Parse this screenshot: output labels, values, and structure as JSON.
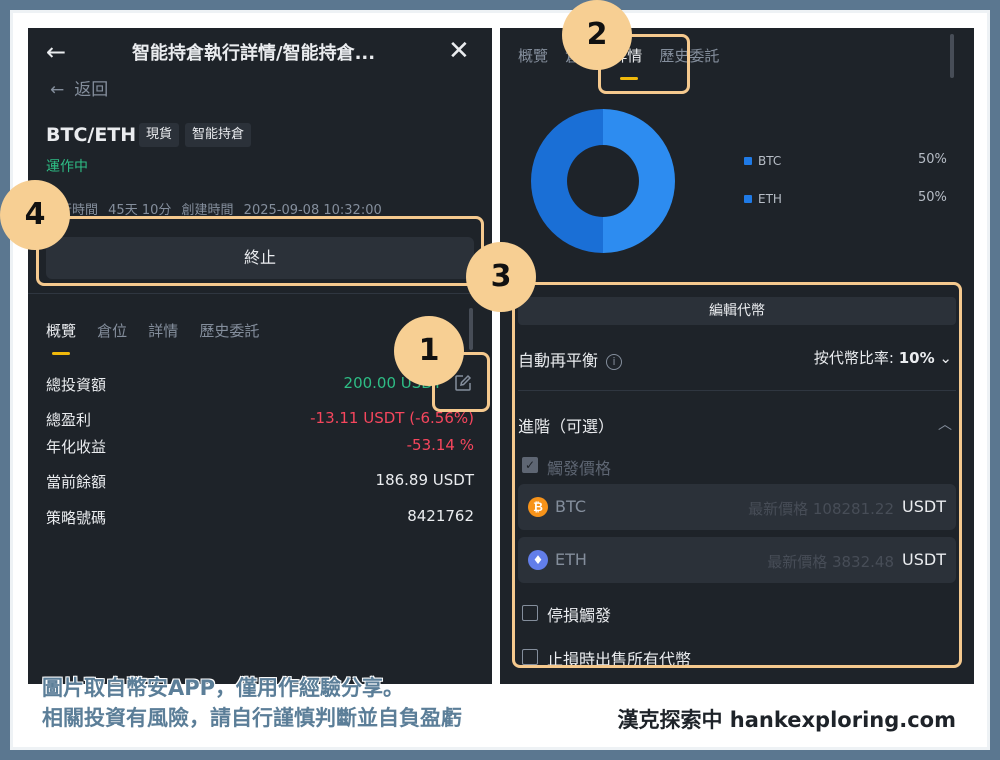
{
  "left": {
    "header": {
      "title": "智能持倉執行詳情/智能持倉..."
    },
    "back_label": "返回",
    "pair": "BTC/ETH",
    "tags": [
      "現貨",
      "智能持倉"
    ],
    "status": "運作中",
    "time_info": {
      "runtime_label": "運行時間",
      "runtime_value": "45天 10分",
      "created_label": "創建時間",
      "created_value": "2025-09-08 10:32:00"
    },
    "terminate_label": "終止",
    "tabs": [
      "概覽",
      "倉位",
      "詳情",
      "歷史委託"
    ],
    "rows": {
      "total_investment": {
        "label": "總投資額",
        "value": "200.00 USDT"
      },
      "total_pnl": {
        "label": "總盈利",
        "value": "-13.11 USDT (-6.56%)"
      },
      "annualized": {
        "label": "年化收益",
        "value": "-53.14 %"
      },
      "balance": {
        "label": "當前餘額",
        "value": "186.89 USDT"
      },
      "strategy_id": {
        "label": "策略號碼",
        "value": "8421762"
      }
    }
  },
  "right": {
    "tabs": [
      "概覽",
      "倉位",
      "詳情",
      "歷史委託"
    ],
    "allocation": [
      {
        "name": "BTC",
        "pct": "50%",
        "fraction": 0.5,
        "color": "#2d8cf0"
      },
      {
        "name": "ETH",
        "pct": "50%",
        "fraction": 0.5,
        "color": "#1a6fd6"
      }
    ],
    "edit_tokens_label": "編輯代幣",
    "rebalance": {
      "label": "自動再平衡",
      "mode": "按代幣比率:",
      "value": "10%"
    },
    "advanced_label": "進階（可選）",
    "trigger_price": {
      "label": "觸發價格",
      "checked": true
    },
    "prices": [
      {
        "coin": "BTC",
        "placeholder": "最新價格 108281.22",
        "unit": "USDT",
        "icon_color": "#f7931a",
        "icon_glyph": "₿"
      },
      {
        "coin": "ETH",
        "placeholder": "最新價格 3832.48",
        "unit": "USDT",
        "icon_color": "#627eea",
        "icon_glyph": "♦"
      }
    ],
    "stop_loss_trigger": "停損觸發",
    "sell_all_on_stop": "止損時出售所有代幣"
  },
  "badges": [
    "1",
    "2",
    "3",
    "4"
  ],
  "caption": {
    "line1": "圖片取自幣安APP，僅用作經驗分享。",
    "line2": "相關投資有風險，請自行謹慎判斷並自負盈虧",
    "brand": "漢克探索中 hankexploring.com"
  }
}
